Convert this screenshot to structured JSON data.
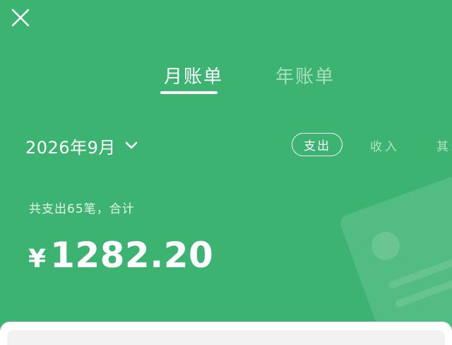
{
  "header": {
    "close_icon": "close-icon"
  },
  "tabs": [
    {
      "label": "月账单",
      "active": true
    },
    {
      "label": "年账单",
      "active": false
    }
  ],
  "month_selector": {
    "label": "2026年9月",
    "icon": "chevron-down-icon"
  },
  "filters": {
    "expense": "支出",
    "income": "收入",
    "other": "其他"
  },
  "summary": {
    "caption": "共支出65笔，合计",
    "currency": "¥",
    "amount": "1282.20"
  },
  "colors": {
    "background": "#3cb371",
    "text": "#ffffff",
    "sheet": "#ffffff"
  }
}
